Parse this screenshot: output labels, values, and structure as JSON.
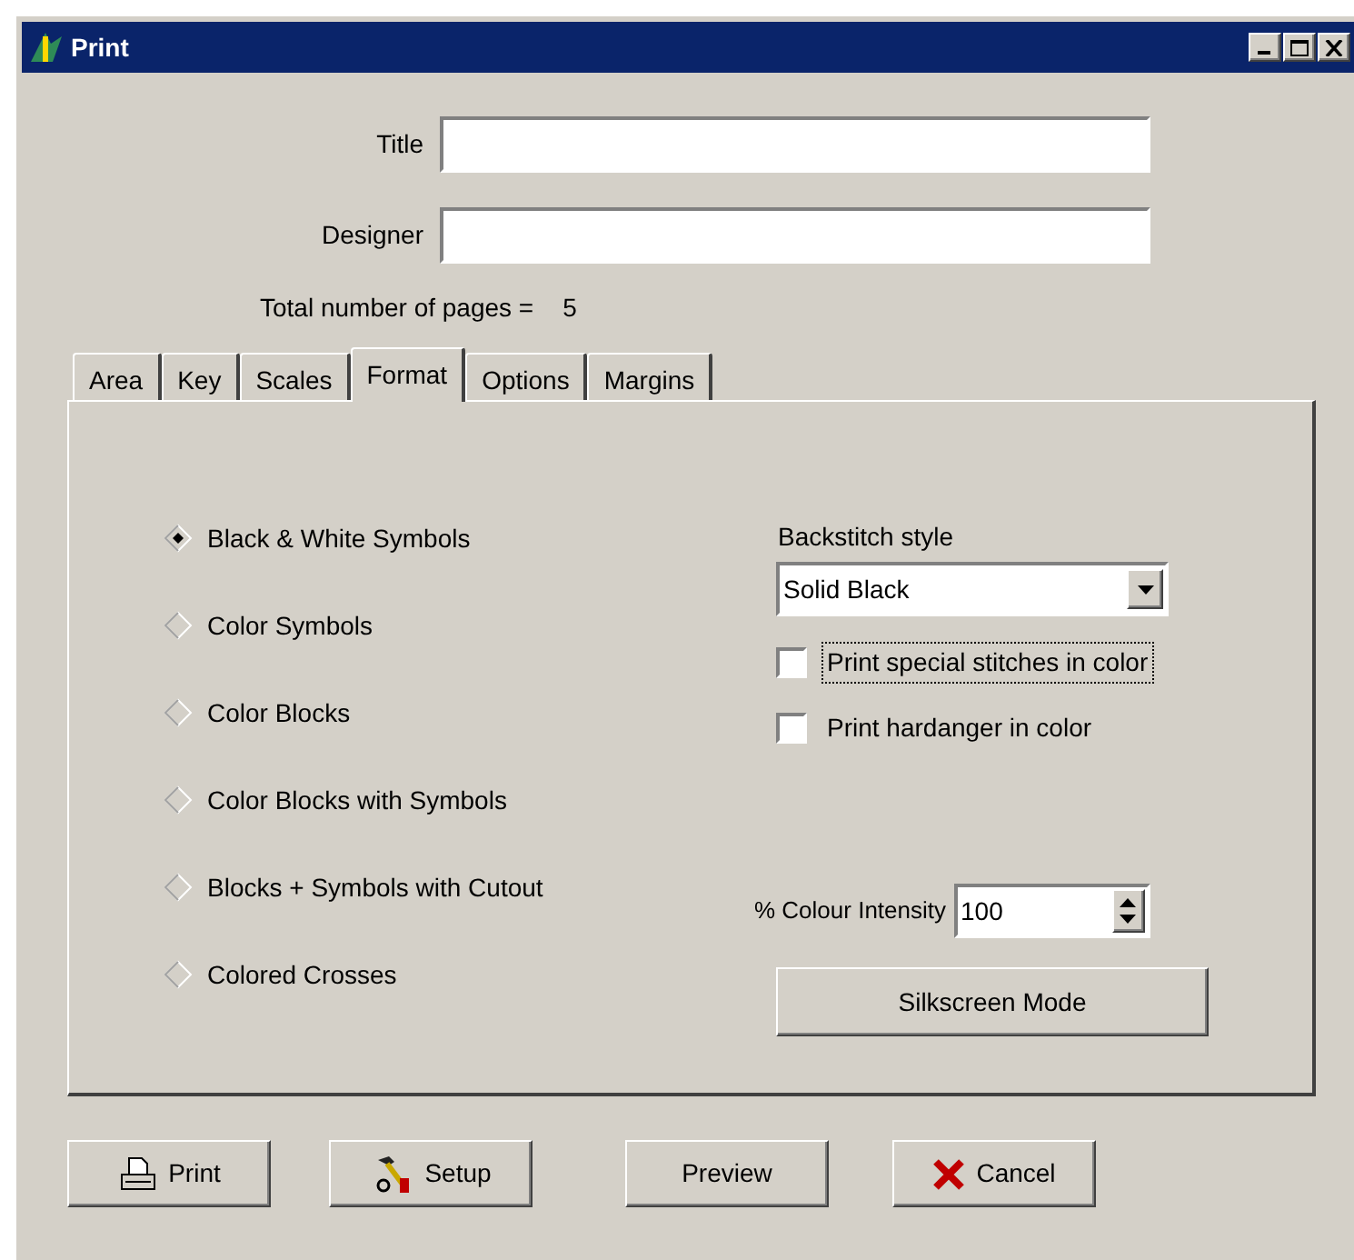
{
  "window": {
    "title": "Print"
  },
  "fields": [
    {
      "label": "Title"
    },
    {
      "label": "Designer"
    }
  ],
  "total_pages": {
    "label": "Total number of pages =",
    "value": "5"
  },
  "tabs": [
    {
      "label": "Area",
      "selected": false
    },
    {
      "label": "Key",
      "selected": false
    },
    {
      "label": "Scales",
      "selected": false
    },
    {
      "label": "Format",
      "selected": true
    },
    {
      "label": "Options",
      "selected": false
    },
    {
      "label": "Margins",
      "selected": false
    }
  ],
  "print_styles": [
    {
      "label": "Black & White Symbols",
      "selected": true
    },
    {
      "label": "Color Symbols",
      "selected": false
    },
    {
      "label": "Color Blocks",
      "selected": false
    },
    {
      "label": "Color Blocks with Symbols",
      "selected": false
    },
    {
      "label": "Blocks + Symbols with Cutout",
      "selected": false
    },
    {
      "label": "Colored Crosses",
      "selected": false
    }
  ],
  "backstitch": {
    "label": "Backstitch style",
    "value": "Solid Black"
  },
  "checkboxes": [
    {
      "label": "Print special stitches in color",
      "checked": false,
      "focused": true
    },
    {
      "label": "Print hardanger in color",
      "checked": false,
      "focused": false
    }
  ],
  "intensity": {
    "label": "% Colour Intensity",
    "value": "100"
  },
  "silkscreen_button": "Silkscreen Mode",
  "buttons": [
    {
      "label": "Print",
      "kind": "print"
    },
    {
      "label": "Setup",
      "kind": "setup"
    },
    {
      "label": "Preview",
      "kind": "plain"
    },
    {
      "label": "Cancel",
      "kind": "cancel"
    }
  ]
}
